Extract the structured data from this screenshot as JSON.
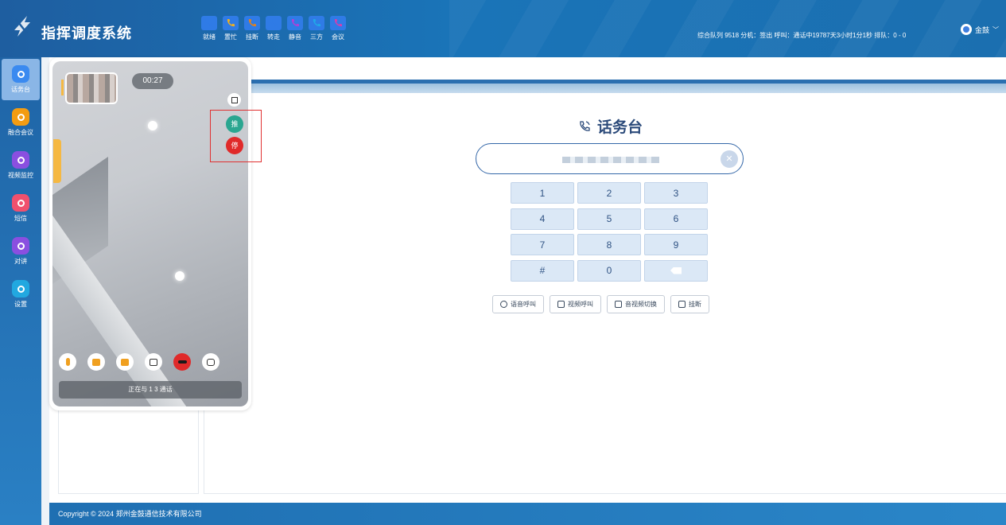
{
  "header": {
    "app_title": "指挥调度系统",
    "call_buttons": [
      {
        "label": "就绪",
        "color": "#2f7be6",
        "icon": "phone-icon"
      },
      {
        "label": "置忙",
        "color": "#f0b020",
        "icon": "phone-icon"
      },
      {
        "label": "挂断",
        "color": "#e08020",
        "icon": "phone-icon"
      },
      {
        "label": "转走",
        "color": "#2f7be6",
        "icon": "phone-icon"
      },
      {
        "label": "静音",
        "color": "#b040d8",
        "icon": "phone-icon"
      },
      {
        "label": "三方",
        "color": "#20a8e8",
        "icon": "phone-icon"
      },
      {
        "label": "会议",
        "color": "#d040b0",
        "icon": "phone-icon"
      }
    ],
    "status_text": "综合队列   9518  分机：签出  呼叫：通话中19787天3小时1分1秒  排队：0 - 0",
    "user_name": "金鼓"
  },
  "sidebar": {
    "items": [
      {
        "label": "话务台",
        "color": "#3a8af0",
        "icon": "headset-icon",
        "active": true
      },
      {
        "label": "融合会议",
        "color": "#f39c12",
        "icon": "conference-icon",
        "active": false
      },
      {
        "label": "视频监控",
        "color": "#8a4fe0",
        "icon": "video-monitor-icon",
        "active": false
      },
      {
        "label": "短信",
        "color": "#f0506e",
        "icon": "sms-icon",
        "active": false
      },
      {
        "label": "对讲",
        "color": "#8a4fe0",
        "icon": "intercom-icon",
        "active": false
      },
      {
        "label": "设置",
        "color": "#22a8e0",
        "icon": "settings-icon",
        "active": false
      }
    ]
  },
  "main": {
    "title": "话务台",
    "title_icon": "phone-outline-icon",
    "dial_input_value": "",
    "keypad": [
      "1",
      "2",
      "3",
      "4",
      "5",
      "6",
      "7",
      "8",
      "9",
      "#",
      "0",
      "⌫"
    ],
    "actions": [
      {
        "label": "语音呼叫",
        "icon": "voice-call-icon"
      },
      {
        "label": "视频呼叫",
        "icon": "video-call-icon"
      },
      {
        "label": "音视频切换",
        "icon": "av-switch-icon"
      },
      {
        "label": "挂断",
        "icon": "hangup-icon"
      }
    ]
  },
  "video_call": {
    "timer": "00:27",
    "push_label": "推",
    "stop_label": "停",
    "push_color": "#2aa690",
    "stop_color": "#e02a2a",
    "status_text": "正在与 1                3 通话",
    "controls": [
      "mic-icon",
      "camera-switch-icon",
      "screen-share-icon",
      "image-icon",
      "hangup-icon",
      "snapshot-icon"
    ]
  },
  "footer": {
    "copyright": "Copyright © 2024 郑州金鼓通信技术有限公司"
  }
}
